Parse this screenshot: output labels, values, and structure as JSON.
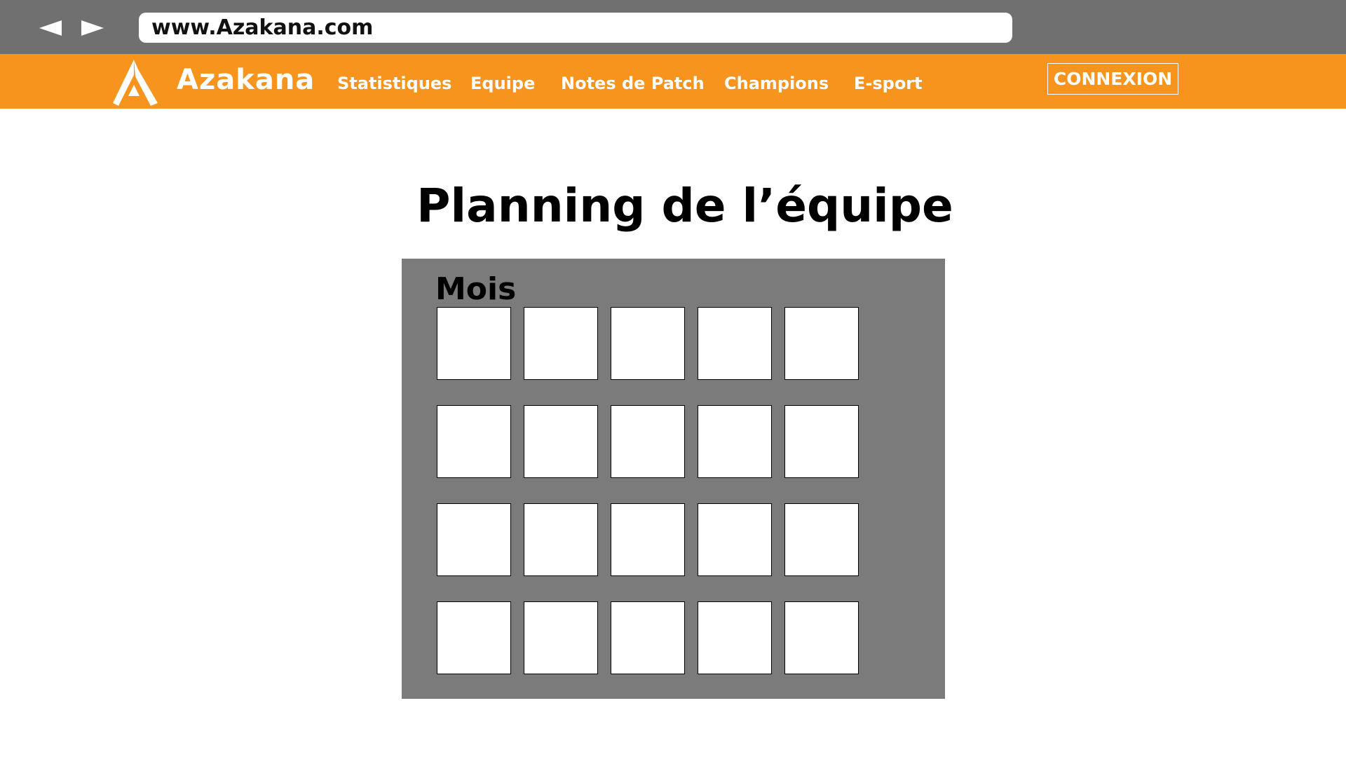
{
  "browser": {
    "back_icon": "back-arrow-icon",
    "forward_icon": "forward-arrow-icon",
    "url": "www.Azakana.com"
  },
  "header": {
    "logo_icon": "azakana-logo-icon",
    "brand": "Azakana",
    "nav": {
      "stats": "Statistiques",
      "team": "Equipe",
      "patch_notes": "Notes de Patch",
      "champions": "Champions",
      "esport": "E-sport"
    },
    "login": "CONNEXION"
  },
  "main": {
    "title": "Planning de l’équipe",
    "calendar": {
      "month_label": "Mois",
      "rows": 4,
      "columns": 5
    }
  },
  "colors": {
    "browser_bar": "#707070",
    "header_accent": "#f7941e",
    "calendar_panel": "#7b7b7b",
    "day_cell": "#ffffff"
  }
}
